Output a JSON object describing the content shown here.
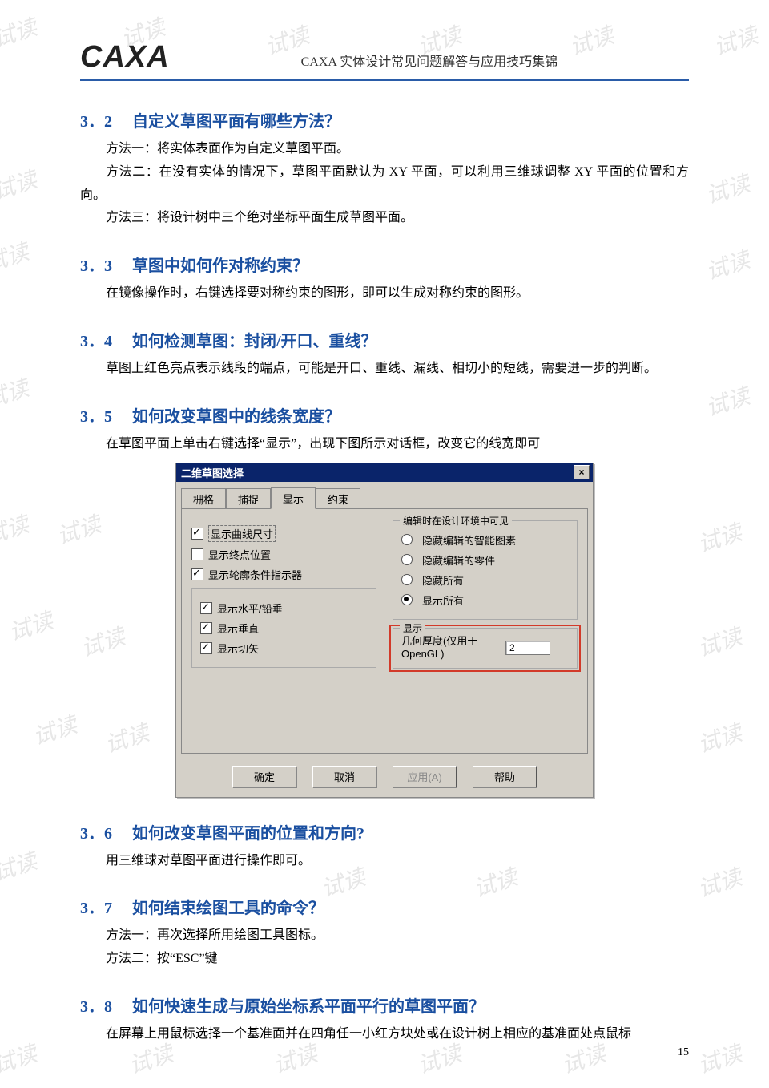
{
  "header": {
    "logo_text": "CAXA",
    "doc_title": "CAXA 实体设计常见问题解答与应用技巧集锦"
  },
  "watermark": "试读",
  "sections": {
    "s32": {
      "num": "3．2",
      "title": "自定义草图平面有哪些方法？",
      "p1": "方法一：将实体表面作为自定义草图平面。",
      "p2": "方法二：在没有实体的情况下，草图平面默认为 XY 平面，可以利用三维球调整 XY 平面的位置和方向。",
      "p3": "方法三：将设计树中三个绝对坐标平面生成草图平面。"
    },
    "s33": {
      "num": "3．3",
      "title": "草图中如何作对称约束？",
      "p1": "在镜像操作时，右键选择要对称约束的图形，即可以生成对称约束的图形。"
    },
    "s34": {
      "num": "3．4",
      "title": "如何检测草图：封闭/开口、重线？",
      "p1": "草图上红色亮点表示线段的端点，可能是开口、重线、漏线、相切小的短线，需要进一步的判断。"
    },
    "s35": {
      "num": "3．5",
      "title": "如何改变草图中的线条宽度？",
      "p1": "在草图平面上单击右键选择“显示”，出现下图所示对话框，改变它的线宽即可"
    },
    "s36": {
      "num": "3．6",
      "title": "如何改变草图平面的位置和方向?",
      "p1": "用三维球对草图平面进行操作即可。"
    },
    "s37": {
      "num": "3．7",
      "title": "如何结束绘图工具的命令？",
      "p1": "方法一：再次选择所用绘图工具图标。",
      "p2": "方法二：按“ESC”键"
    },
    "s38": {
      "num": "3．8",
      "title": "如何快速生成与原始坐标系平面平行的草图平面？",
      "p1": "在屏幕上用鼠标选择一个基准面并在四角任一小红方块处或在设计树上相应的基准面处点鼠标"
    }
  },
  "dialog": {
    "title": "二维草图选择",
    "close_icon": "×",
    "tabs": [
      "栅格",
      "捕捉",
      "显示",
      "约束"
    ],
    "active_tab_index": 2,
    "left": {
      "show_curve_size": "显示曲线尺寸",
      "show_endpoint_pos": "显示终点位置",
      "show_profile_indicator": "显示轮廓条件指示器",
      "show_hv": "显示水平/铅垂",
      "show_vert": "显示垂直",
      "show_tan": "显示切矢"
    },
    "right": {
      "env_group_title": "编辑时在设计环境中可见",
      "opt_hide_smart": "隐藏编辑的智能图素",
      "opt_hide_parts": "隐藏编辑的零件",
      "opt_hide_all": "隐藏所有",
      "opt_show_all": "显示所有",
      "display_group_title": "显示",
      "thickness_label": "几何厚度(仅用于OpenGL)",
      "thickness_value": "2"
    },
    "buttons": {
      "ok": "确定",
      "cancel": "取消",
      "apply": "应用(A)",
      "help": "帮助"
    }
  },
  "page_number": "15"
}
